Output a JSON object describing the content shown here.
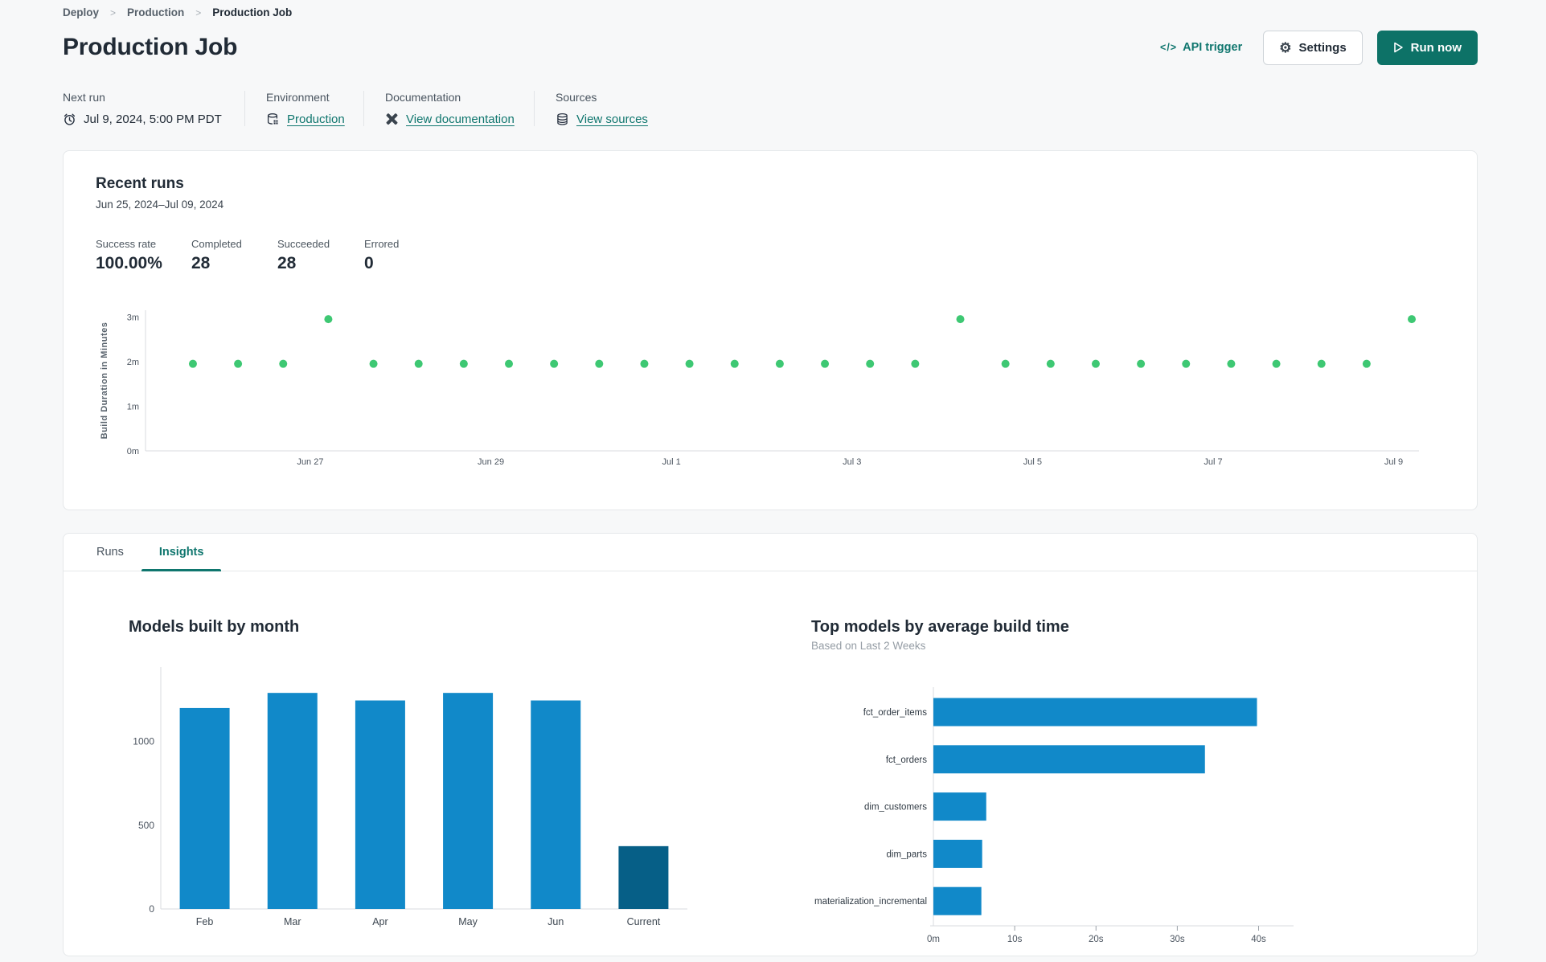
{
  "breadcrumb": {
    "separator": ">",
    "items": [
      {
        "label": "Deploy"
      },
      {
        "label": "Production"
      },
      {
        "label": "Production Job"
      }
    ]
  },
  "header": {
    "title": "Production Job",
    "api_trigger": {
      "icon_glyph": "</>",
      "label": "API trigger"
    },
    "settings": {
      "icon_glyph": "⚙",
      "label": "Settings"
    },
    "run_now": {
      "label": "Run now"
    }
  },
  "meta": {
    "columns": [
      {
        "icon": "clock-icon",
        "label": "Next run",
        "value": "Jul 9, 2024, 5:00 PM PDT",
        "is_link": false
      },
      {
        "icon": "database-icon",
        "label": "Environment",
        "value": "Production",
        "is_link": true
      },
      {
        "icon": "dbt-logo-icon",
        "label": "Documentation",
        "value": "View documentation",
        "is_link": true
      },
      {
        "icon": "sources-icon",
        "label": "Sources",
        "value": "View sources",
        "is_link": true
      }
    ]
  },
  "recent_runs": {
    "title": "Recent runs",
    "date_range": "Jun 25, 2024–Jul 09, 2024",
    "stats": [
      {
        "label": "Success rate",
        "value": "100.00%"
      },
      {
        "label": "Completed",
        "value": "28"
      },
      {
        "label": "Succeeded",
        "value": "28"
      },
      {
        "label": "Errored",
        "value": "0"
      }
    ]
  },
  "tabs": [
    {
      "label": "Runs",
      "active": false
    },
    {
      "label": "Insights",
      "active": true
    }
  ],
  "colors": {
    "accent_teal": "#0f766e",
    "run_dot_green": "#3ec873",
    "bar_blue": "#1189c9",
    "bar_dark_blue": "#065f87",
    "axis_gray": "#d8dbdf",
    "text_dark": "#212b36"
  },
  "chart_data": [
    {
      "type": "scatter",
      "ylabel": "Build Duration in Minutes",
      "point_color": "#3ec873",
      "xlim": [
        0.175,
        14.28
      ],
      "ylim": [
        0,
        3.15
      ],
      "yticks": [
        {
          "v": 0,
          "label": "0m"
        },
        {
          "v": 1,
          "label": "1m"
        },
        {
          "v": 2,
          "label": "2m"
        },
        {
          "v": 3,
          "label": "3m"
        }
      ],
      "xticks": [
        {
          "v": 2,
          "label": "Jun 27"
        },
        {
          "v": 4,
          "label": "Jun 29"
        },
        {
          "v": 6,
          "label": "Jul 1"
        },
        {
          "v": 8,
          "label": "Jul 3"
        },
        {
          "v": 10,
          "label": "Jul 5"
        },
        {
          "v": 12,
          "label": "Jul 7"
        },
        {
          "v": 14,
          "label": "Jul 9"
        }
      ],
      "points": [
        {
          "d": 0.7,
          "m": 1.95
        },
        {
          "d": 1.2,
          "m": 1.95
        },
        {
          "d": 1.7,
          "m": 1.95
        },
        {
          "d": 2.2,
          "m": 2.95
        },
        {
          "d": 2.7,
          "m": 1.95
        },
        {
          "d": 3.2,
          "m": 1.95
        },
        {
          "d": 3.7,
          "m": 1.95
        },
        {
          "d": 4.2,
          "m": 1.95
        },
        {
          "d": 4.7,
          "m": 1.95
        },
        {
          "d": 5.2,
          "m": 1.95
        },
        {
          "d": 5.7,
          "m": 1.95
        },
        {
          "d": 6.2,
          "m": 1.95
        },
        {
          "d": 6.7,
          "m": 1.95
        },
        {
          "d": 7.2,
          "m": 1.95
        },
        {
          "d": 7.7,
          "m": 1.95
        },
        {
          "d": 8.2,
          "m": 1.95
        },
        {
          "d": 8.7,
          "m": 1.95
        },
        {
          "d": 9.2,
          "m": 2.95
        },
        {
          "d": 9.7,
          "m": 1.95
        },
        {
          "d": 10.2,
          "m": 1.95
        },
        {
          "d": 10.7,
          "m": 1.95
        },
        {
          "d": 11.2,
          "m": 1.95
        },
        {
          "d": 11.7,
          "m": 1.95
        },
        {
          "d": 12.2,
          "m": 1.95
        },
        {
          "d": 12.7,
          "m": 1.95
        },
        {
          "d": 13.2,
          "m": 1.95
        },
        {
          "d": 13.7,
          "m": 1.95
        },
        {
          "d": 14.2,
          "m": 2.95
        }
      ]
    },
    {
      "type": "bar",
      "title": "Models built by month",
      "categories": [
        "Feb",
        "Mar",
        "Apr",
        "May",
        "Jun",
        "Current"
      ],
      "values": [
        1200,
        1290,
        1245,
        1290,
        1245,
        375
      ],
      "yticks": [
        0,
        500,
        1000
      ],
      "ylim": [
        0,
        1430
      ],
      "bar_color": "#1189c9",
      "highlight_index": 5,
      "highlight_color": "#065f87"
    },
    {
      "type": "hbar",
      "title": "Top models by average build time",
      "subtitle": "Based on Last 2 Weeks",
      "categories": [
        "fct_order_items",
        "fct_orders",
        "dim_customers",
        "dim_parts",
        "materialization_incremental"
      ],
      "values": [
        39.8,
        33.4,
        6.5,
        6.0,
        5.9
      ],
      "xticks": [
        {
          "v": 0,
          "label": "0m"
        },
        {
          "v": 10,
          "label": "10s"
        },
        {
          "v": 20,
          "label": "20s"
        },
        {
          "v": 30,
          "label": "30s"
        },
        {
          "v": 40,
          "label": "40s"
        }
      ],
      "xlim": [
        0,
        44.3
      ],
      "bar_color": "#1189c9"
    }
  ]
}
